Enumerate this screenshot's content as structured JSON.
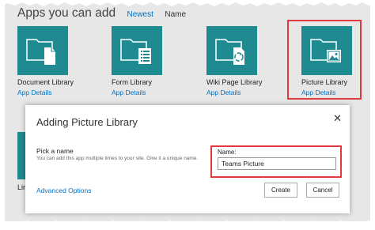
{
  "header": {
    "title": "Apps you can add",
    "sort_newest": "Newest",
    "sort_name": "Name"
  },
  "tiles": [
    {
      "name": "Document Library",
      "details": "App Details",
      "icon": "document-library-icon"
    },
    {
      "name": "Form Library",
      "details": "App Details",
      "icon": "form-library-icon"
    },
    {
      "name": "Wiki Page Library",
      "details": "App Details",
      "icon": "wiki-page-library-icon"
    },
    {
      "name": "Picture Library",
      "details": "App Details",
      "icon": "picture-library-icon"
    }
  ],
  "partial_tile_text": "Lir",
  "dialog": {
    "title": "Adding Picture Library",
    "close_icon": "close-icon",
    "pick_label": "Pick a name",
    "help_text": "You can add this app multiple times to your site. Give it a unique name.",
    "advanced_options": "Advanced Options",
    "name_label": "Name:",
    "name_value": "Teams Picture",
    "create_label": "Create",
    "cancel_label": "Cancel"
  },
  "colors": {
    "tile": "#1f8a90",
    "link": "#0072c6",
    "highlight": "#e0393e",
    "background": "#e7e7e7"
  }
}
